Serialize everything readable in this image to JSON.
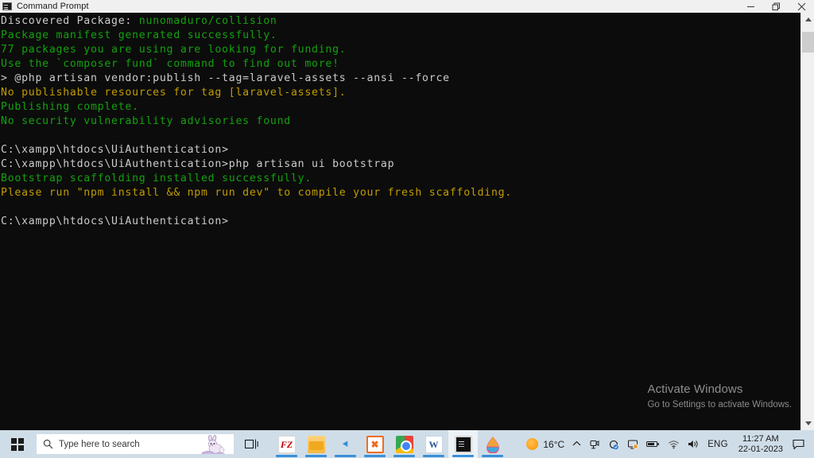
{
  "window": {
    "title": "Command Prompt",
    "icon": "console-icon",
    "buttons": {
      "minimize": "minimize-button",
      "restore": "restore-button",
      "close": "close-button"
    }
  },
  "console": {
    "background": "#0c0c0c",
    "colors": {
      "white": "#cccccc",
      "green": "#13a10e",
      "yellow": "#c19c00"
    },
    "lines": [
      {
        "segments": [
          {
            "text": "Discovered Package: ",
            "color": "white"
          },
          {
            "text": "nunomaduro/collision",
            "color": "green"
          }
        ]
      },
      {
        "segments": [
          {
            "text": "Package manifest generated successfully.",
            "color": "green"
          }
        ]
      },
      {
        "segments": [
          {
            "text": "77 packages you are using are looking for funding.",
            "color": "green"
          }
        ]
      },
      {
        "segments": [
          {
            "text": "Use the `composer fund` command to find out more!",
            "color": "green"
          }
        ]
      },
      {
        "segments": [
          {
            "text": "> @php artisan vendor:publish --tag=laravel-assets --ansi --force",
            "color": "white"
          }
        ]
      },
      {
        "segments": [
          {
            "text": "No publishable resources for tag [laravel-assets].",
            "color": "yellow"
          }
        ]
      },
      {
        "segments": [
          {
            "text": "Publishing complete.",
            "color": "green"
          }
        ]
      },
      {
        "segments": [
          {
            "text": "No security vulnerability advisories found",
            "color": "green"
          }
        ]
      },
      {
        "segments": [
          {
            "text": "",
            "color": "white"
          }
        ]
      },
      {
        "segments": [
          {
            "text": "C:\\xampp\\htdocs\\UiAuthentication>",
            "color": "white"
          }
        ]
      },
      {
        "segments": [
          {
            "text": "C:\\xampp\\htdocs\\UiAuthentication>php artisan ui bootstrap",
            "color": "white"
          }
        ]
      },
      {
        "segments": [
          {
            "text": "Bootstrap scaffolding installed successfully.",
            "color": "green"
          }
        ]
      },
      {
        "segments": [
          {
            "text": "Please run \"npm install && npm run dev\" to compile your fresh scaffolding.",
            "color": "yellow"
          }
        ]
      },
      {
        "segments": [
          {
            "text": "",
            "color": "white"
          }
        ]
      },
      {
        "segments": [
          {
            "text": "C:\\xampp\\htdocs\\UiAuthentication>",
            "color": "white"
          }
        ]
      }
    ]
  },
  "watermark": {
    "title": "Activate Windows",
    "subtitle": "Go to Settings to activate Windows."
  },
  "taskbar": {
    "start": "start-button",
    "search": {
      "placeholder": "Type here to search",
      "icon": "search-icon"
    },
    "task_view": "task-view-button",
    "apps": [
      {
        "name": "filezilla",
        "label": "FZ",
        "css": "ic-filezilla",
        "running": true,
        "active": false
      },
      {
        "name": "file-explorer",
        "label": "",
        "css": "ic-explorer",
        "running": true,
        "active": false
      },
      {
        "name": "visual-studio-code",
        "label": "⯇",
        "css": "ic-vscode",
        "running": true,
        "active": false
      },
      {
        "name": "xampp-control-panel",
        "label": "✖",
        "css": "ic-xampp",
        "running": true,
        "active": false
      },
      {
        "name": "google-chrome",
        "label": "",
        "css": "ic-chrome",
        "running": true,
        "active": false
      },
      {
        "name": "microsoft-word",
        "label": "W",
        "css": "ic-word",
        "running": true,
        "active": false
      },
      {
        "name": "command-prompt",
        "label": "",
        "css": "ic-cmd",
        "running": true,
        "active": true
      },
      {
        "name": "color-drop-app",
        "label": "",
        "css": "ic-drop",
        "running": true,
        "active": false
      }
    ],
    "tray": {
      "weather_temp": "16°C",
      "show_hidden": "∧",
      "icons": [
        "webcam-icon",
        "chrome-sync-icon",
        "display-settings-icon",
        "battery-icon",
        "wifi-icon",
        "volume-icon"
      ],
      "language": "ENG",
      "time": "11:27 AM",
      "date": "22-01-2023",
      "notifications": "notification-center-icon"
    }
  }
}
